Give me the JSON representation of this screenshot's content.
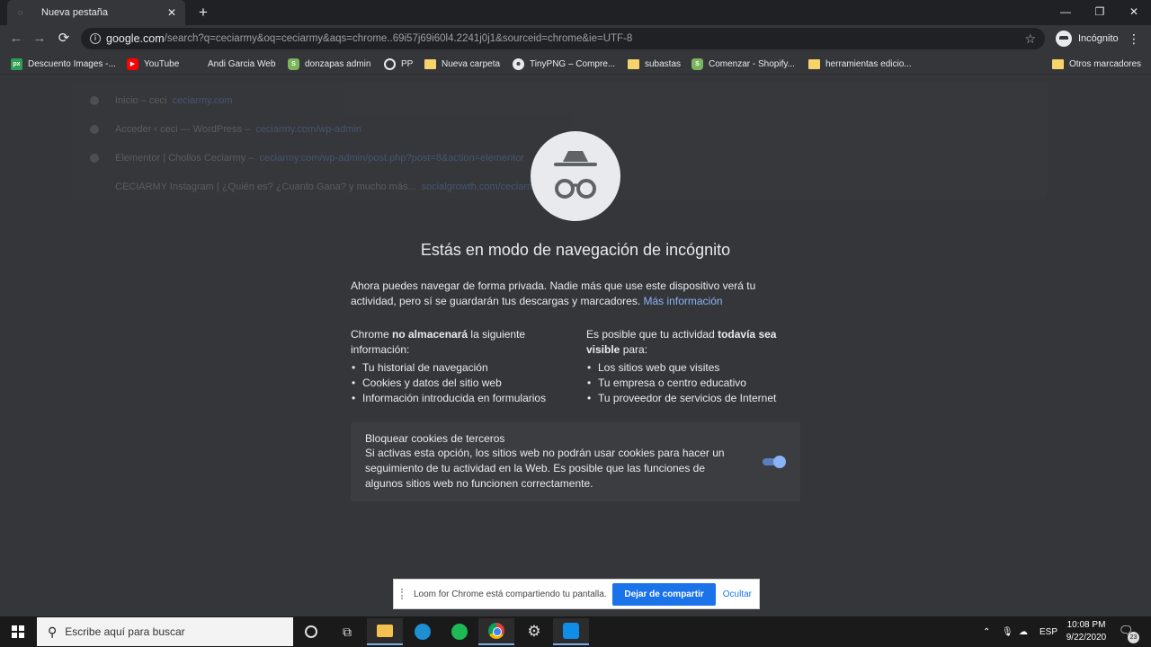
{
  "tab": {
    "title": "Nueva pestaña",
    "close": "✕",
    "spinner": "◌"
  },
  "newtab": "+",
  "window": {
    "minimize": "—",
    "maximize": "❐",
    "close": "✕"
  },
  "toolbar": {
    "back": "←",
    "forward": "→",
    "reload": "⟳",
    "url_host": "google.com",
    "url_path": "/search?q=ceciarmy&oq=ceciarmy&aqs=chrome..69i57j69i60l4.2241j0j1&sourceid=chrome&ie=UTF-8",
    "star": "☆",
    "profile_label": "Incógnito",
    "menu": "⋮"
  },
  "bookmarks": [
    {
      "label": "Descuento Images -...",
      "icon": "px",
      "glyph": "px"
    },
    {
      "label": "YouTube",
      "icon": "yt",
      "glyph": "▶"
    },
    {
      "label": "Andi Garcia Web",
      "icon": "blank",
      "glyph": ""
    },
    {
      "label": "donzapas admin",
      "icon": "shop",
      "glyph": "S"
    },
    {
      "label": "PP",
      "icon": "globe",
      "glyph": ""
    },
    {
      "label": "Nueva carpeta",
      "icon": "folder",
      "glyph": ""
    },
    {
      "label": "TinyPNG – Compre...",
      "icon": "panda",
      "glyph": "☻"
    },
    {
      "label": "subastas",
      "icon": "folder",
      "glyph": ""
    },
    {
      "label": "Comenzar - Shopify...",
      "icon": "shop",
      "glyph": "S"
    },
    {
      "label": "herramientas edicio...",
      "icon": "folder",
      "glyph": ""
    },
    {
      "label": "Otros marcadores",
      "icon": "folder",
      "glyph": ""
    }
  ],
  "ghost_suggestions": [
    {
      "text": "Inicio – ceci",
      "link": "ceciarmy.com"
    },
    {
      "text": "Acceder ‹ ceci — WordPress –",
      "link": "ceciarmy.com/wp-admin"
    },
    {
      "text": "Elementor | Chollos Ceciarmy –",
      "link": "ceciarmy.com/wp-admin/post.php?post=8&action=elementor"
    },
    {
      "text": "CECIARMY Instagram | ¿Quién es? ¿Cuanto Gana? y mucho más...",
      "link": "socialgrowth.com/ceciarmy"
    }
  ],
  "incognito": {
    "headline": "Estás en modo de navegación de incógnito",
    "intro": "Ahora puedes navegar de forma privada. Nadie más que use este dispositivo verá tu actividad, pero sí se guardarán tus descargas y marcadores.",
    "learn_more": "Más información",
    "left_head_pre": "Chrome ",
    "left_head_bold": "no almacenará",
    "left_head_post": " la siguiente información:",
    "left_items": [
      "Tu historial de navegación",
      "Cookies y datos del sitio web",
      "Información introducida en formularios"
    ],
    "right_head_pre": "Es posible que tu actividad ",
    "right_head_bold": "todavía sea visible",
    "right_head_post": " para:",
    "right_items": [
      "Los sitios web que visites",
      "Tu empresa o centro educativo",
      "Tu proveedor de servicios de Internet"
    ],
    "cookie_title": "Bloquear cookies de terceros",
    "cookie_desc": "Si activas esta opción, los sitios web no podrán usar cookies para hacer un seguimiento de tu actividad en la Web. Es posible que las funciones de algunos sitios web no funcionen correctamente.",
    "cookie_toggle_on": true
  },
  "loom": {
    "message": "Loom for Chrome está compartiendo tu pantalla.",
    "stop": "Dejar de compartir",
    "hide": "Ocultar"
  },
  "taskbar": {
    "search_placeholder": "Escribe aquí para buscar",
    "lang": "ESP",
    "time": "10:08 PM",
    "date": "9/22/2020",
    "notifications": "23"
  }
}
